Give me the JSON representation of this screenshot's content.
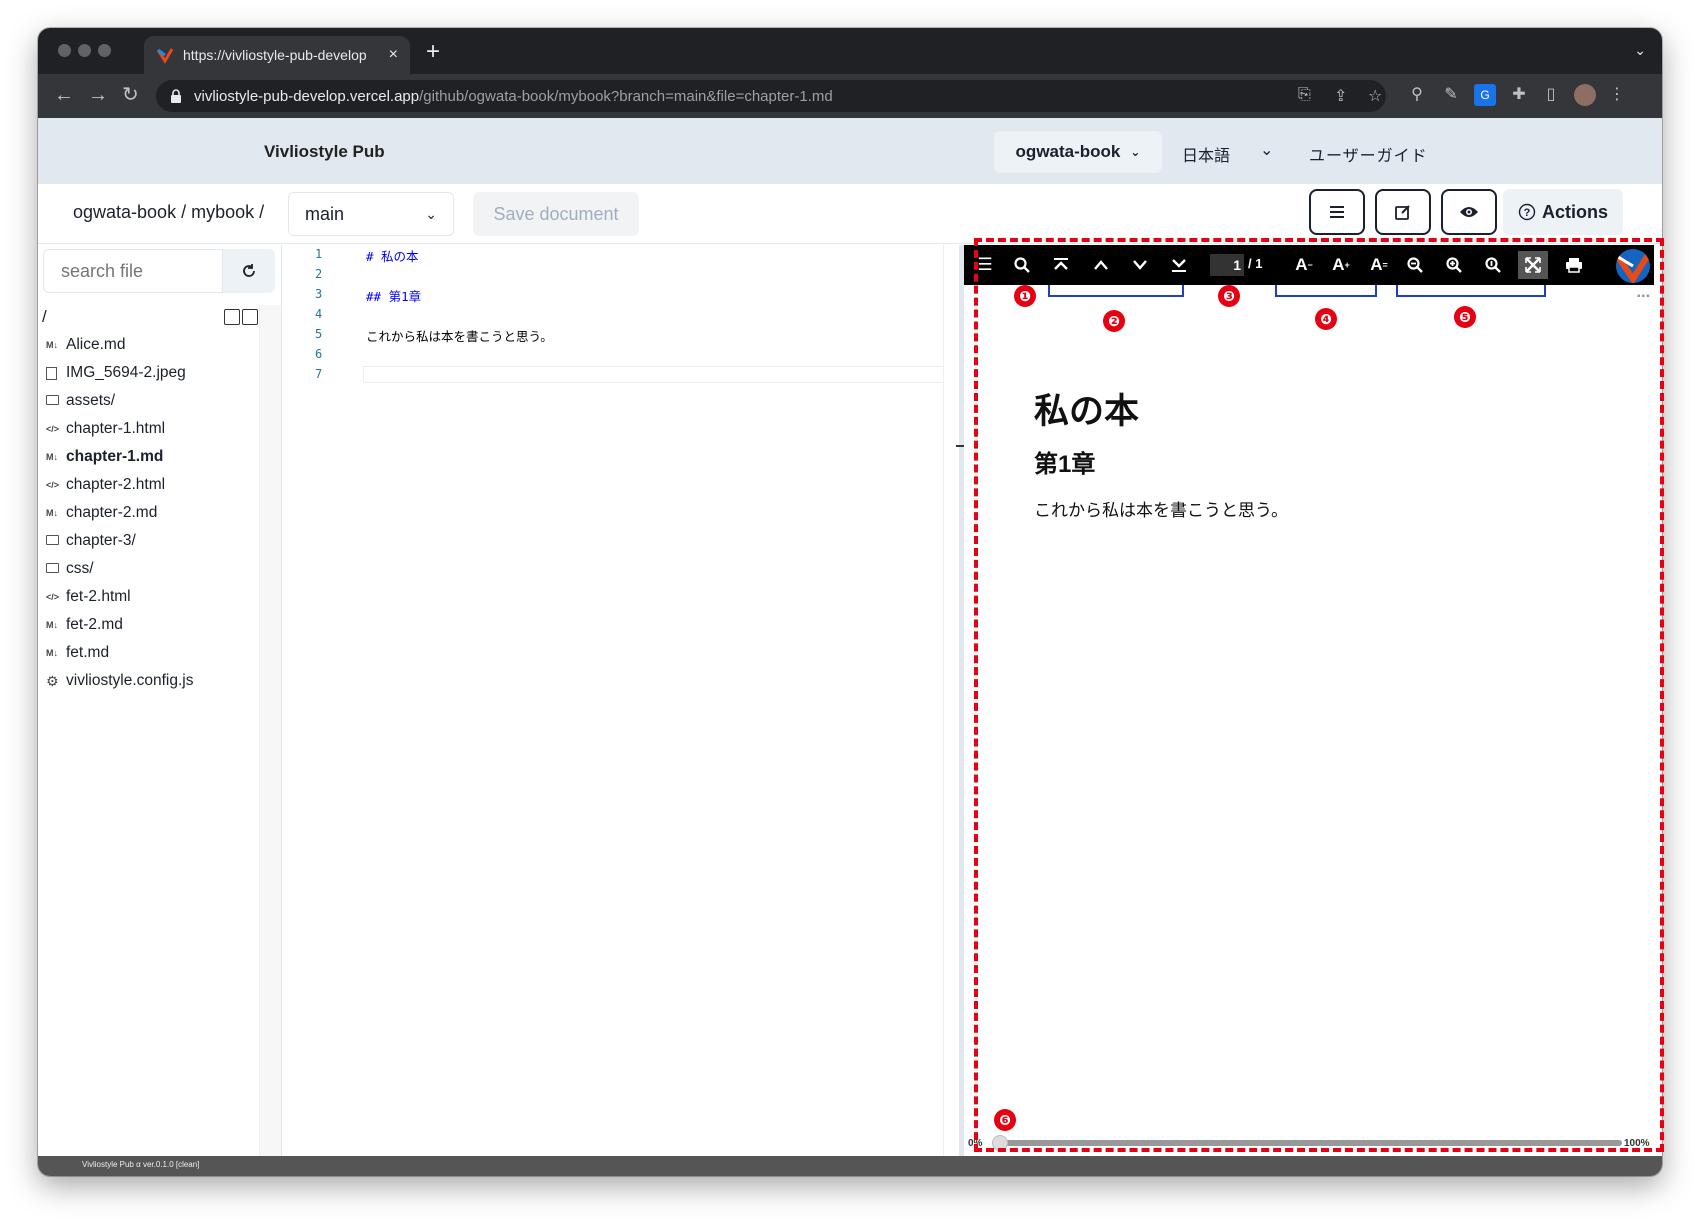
{
  "browser": {
    "tab_title": "https://vivliostyle-pub-develop",
    "tab_close": "×",
    "new_tab": "+",
    "url_host": "vivliostyle-pub-develop.vercel.app",
    "url_path": "/github/ogwata-book/mybook?branch=main&file=chapter-1.md"
  },
  "header": {
    "brand": "Vivliostyle Pub",
    "repo": "ogwata-book",
    "language": "日本語",
    "user_guide": "ユーザーガイド"
  },
  "subheader": {
    "breadcrumb": "ogwata-book / mybook /",
    "branch": "main",
    "save_label": "Save document",
    "actions_label": "Actions"
  },
  "sidebar": {
    "search_placeholder": "search file",
    "root": "/",
    "files": [
      {
        "icon": "M↓",
        "name": "Alice.md"
      },
      {
        "icon": "image",
        "name": "IMG_5694-2.jpeg"
      },
      {
        "icon": "folder",
        "name": "assets/"
      },
      {
        "icon": "</>",
        "name": "chapter-1.html"
      },
      {
        "icon": "M↓",
        "name": "chapter-1.md"
      },
      {
        "icon": "</>",
        "name": "chapter-2.html"
      },
      {
        "icon": "M↓",
        "name": "chapter-2.md"
      },
      {
        "icon": "folder",
        "name": "chapter-3/"
      },
      {
        "icon": "folder",
        "name": "css/"
      },
      {
        "icon": "</>",
        "name": "fet-2.html"
      },
      {
        "icon": "M↓",
        "name": "fet-2.md"
      },
      {
        "icon": "M↓",
        "name": "fet.md"
      },
      {
        "icon": "gear",
        "name": "vivliostyle.config.js"
      }
    ]
  },
  "editor": {
    "line_numbers": [
      "1",
      "2",
      "3",
      "4",
      "5",
      "6",
      "7"
    ],
    "lines": [
      "# 私の本",
      "",
      "## 第1章",
      "",
      "これから私は本を書こうと思う。",
      "",
      ""
    ]
  },
  "viewer": {
    "page_current": "1",
    "page_total": "/ 1",
    "annotations": [
      "❶",
      "❷",
      "❸",
      "❹",
      "❺",
      "❻"
    ],
    "slider_min": "0%",
    "slider_max": "100%",
    "progress": 0
  },
  "document": {
    "h1": "私の本",
    "h2": "第1章",
    "p": "これから私は本を書こうと思う。"
  },
  "status": {
    "version": "Vivliostyle Pub α ver.0.1.0 [clean]"
  },
  "colors": {
    "annotation_red": "#e60012",
    "bracket_blue": "#1f3fbf",
    "header_bg": "#e2e8f0"
  }
}
